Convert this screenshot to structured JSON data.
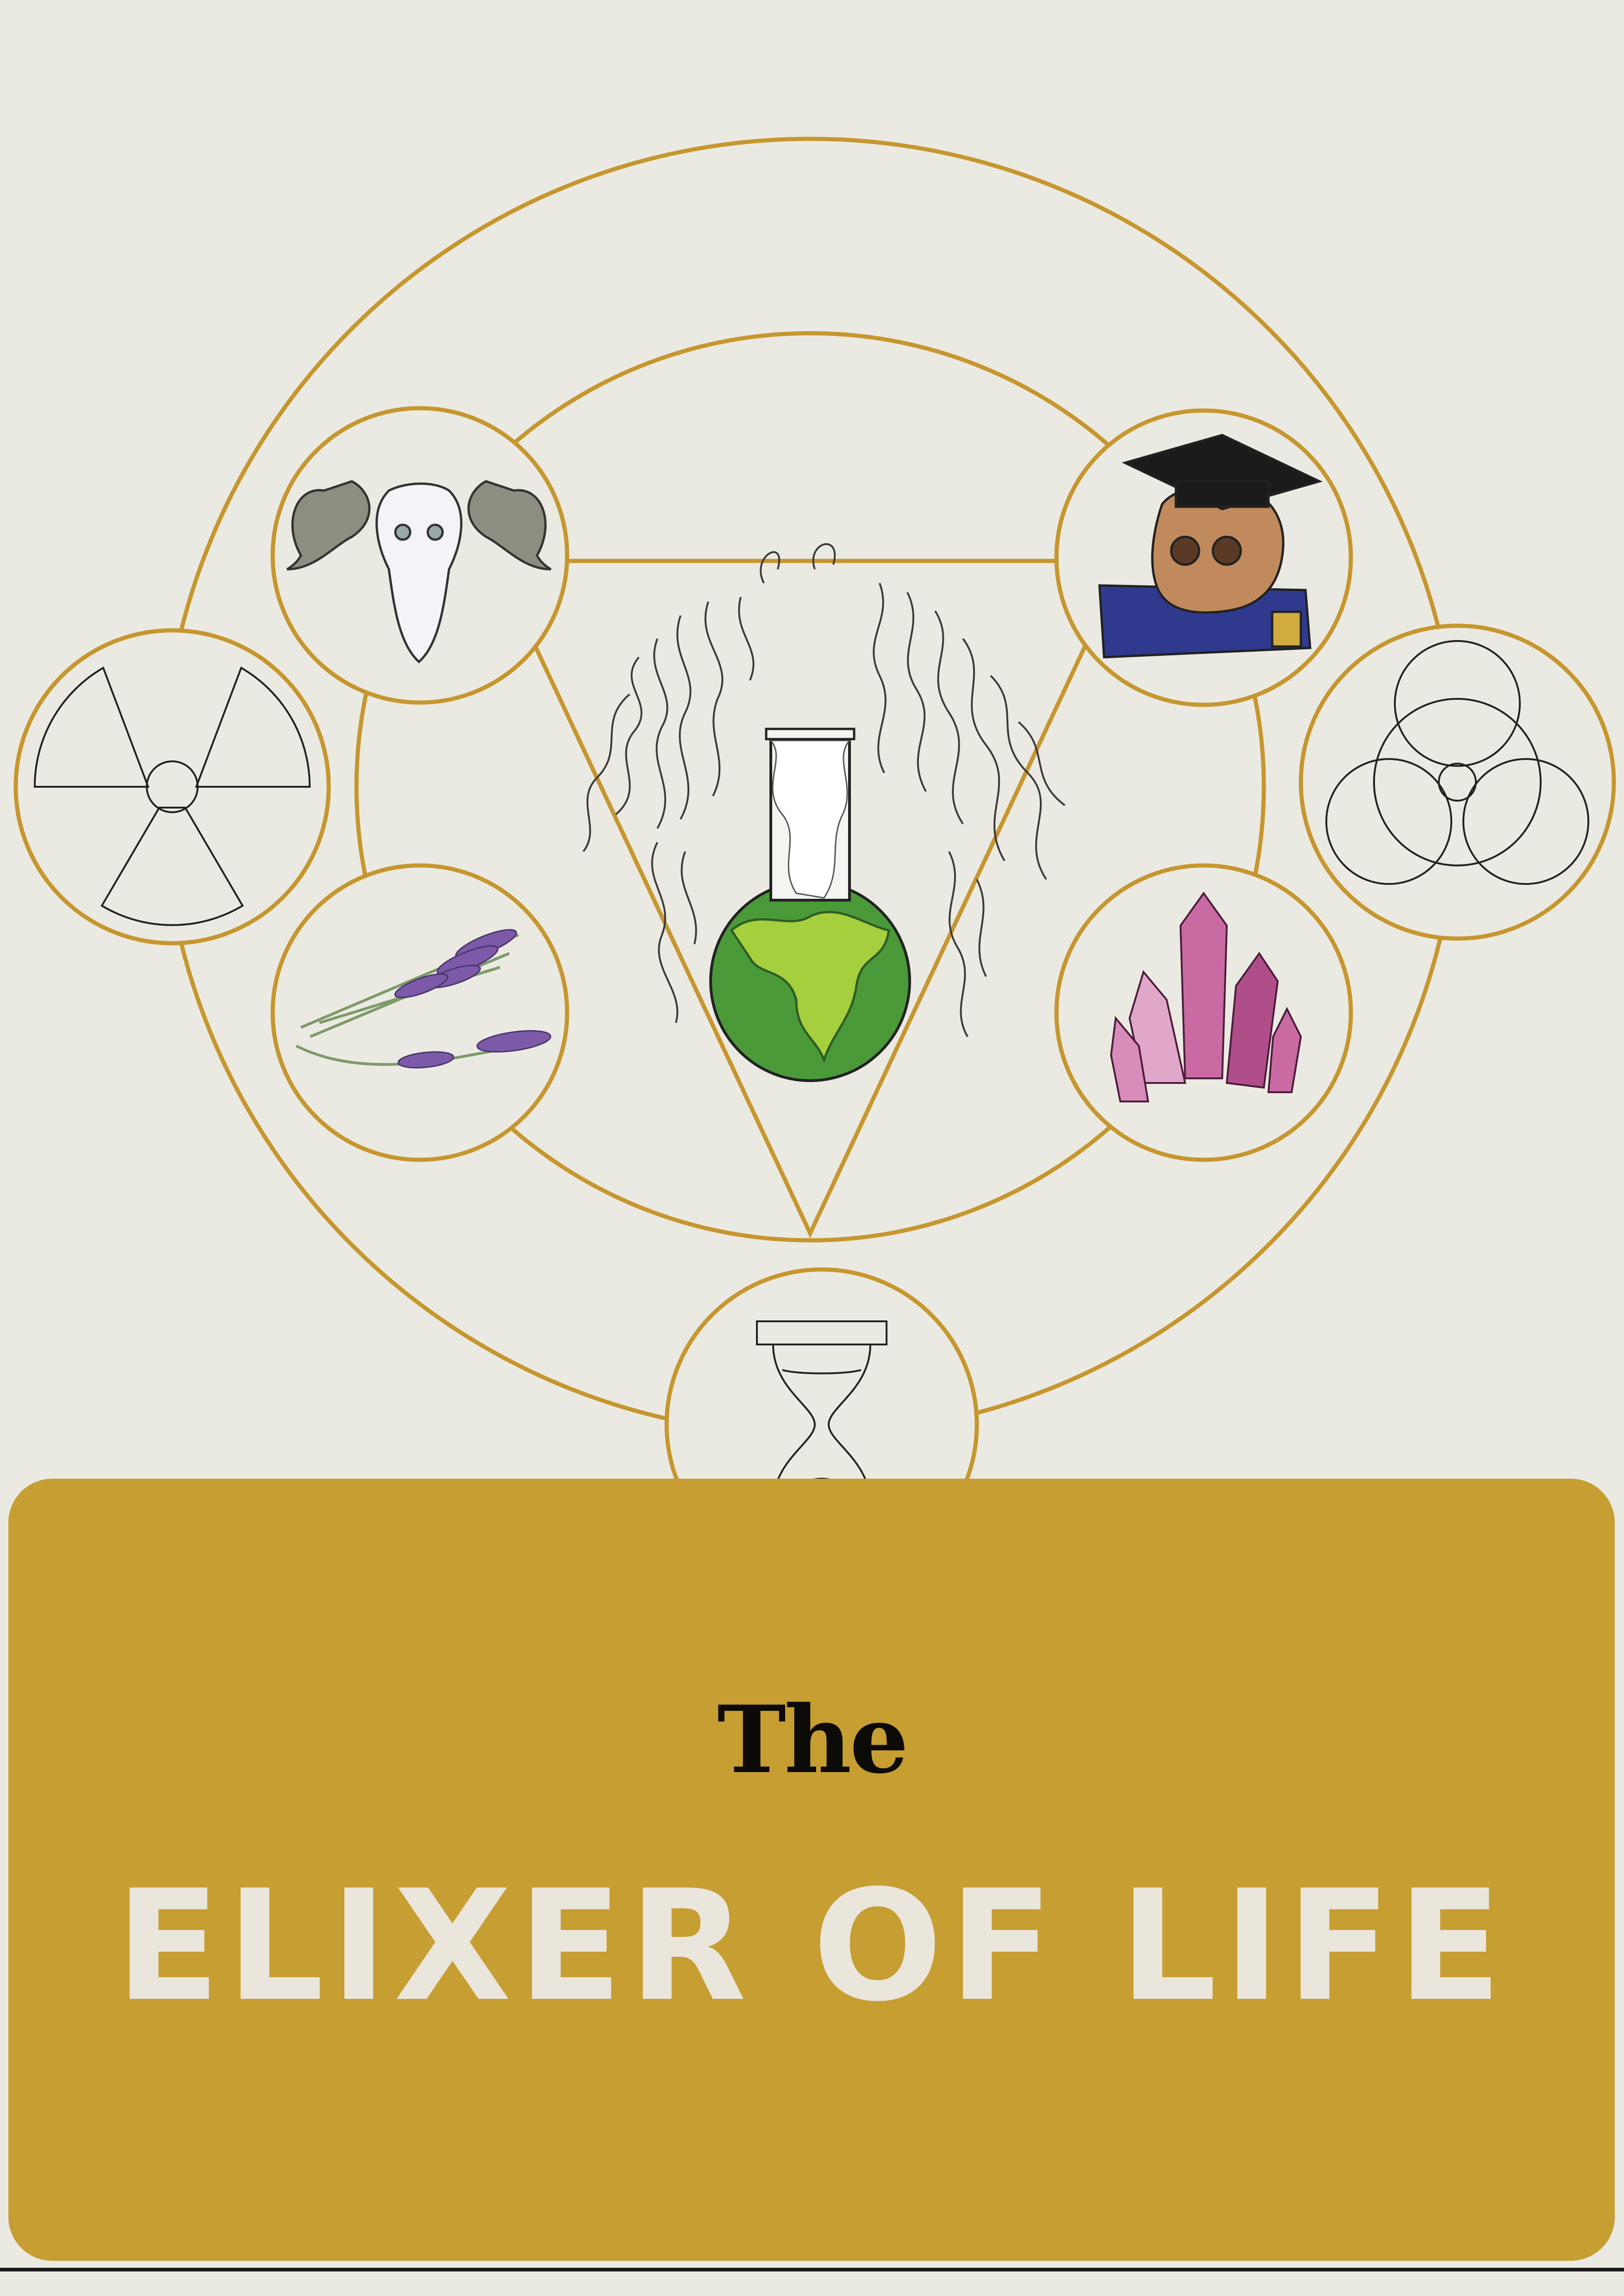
{
  "poster": {
    "title_small": "The",
    "title_main": "ELIXER OF LIFE"
  },
  "colors": {
    "background": "#ebeae2",
    "gold": "#c69e32",
    "line_gold": "#c6962f",
    "title_main": "#ebe6db",
    "title_small": "#0d0b08",
    "potion_green": "#4a9a3a",
    "lime": "#a6cf3d"
  },
  "icons": [
    "ram-skull-icon",
    "radiation-icon",
    "lavender-icon",
    "skull-graduation-cap-icon",
    "biohazard-icon",
    "crystal-icon",
    "hourglass-icon",
    "potion-flask-icon"
  ]
}
